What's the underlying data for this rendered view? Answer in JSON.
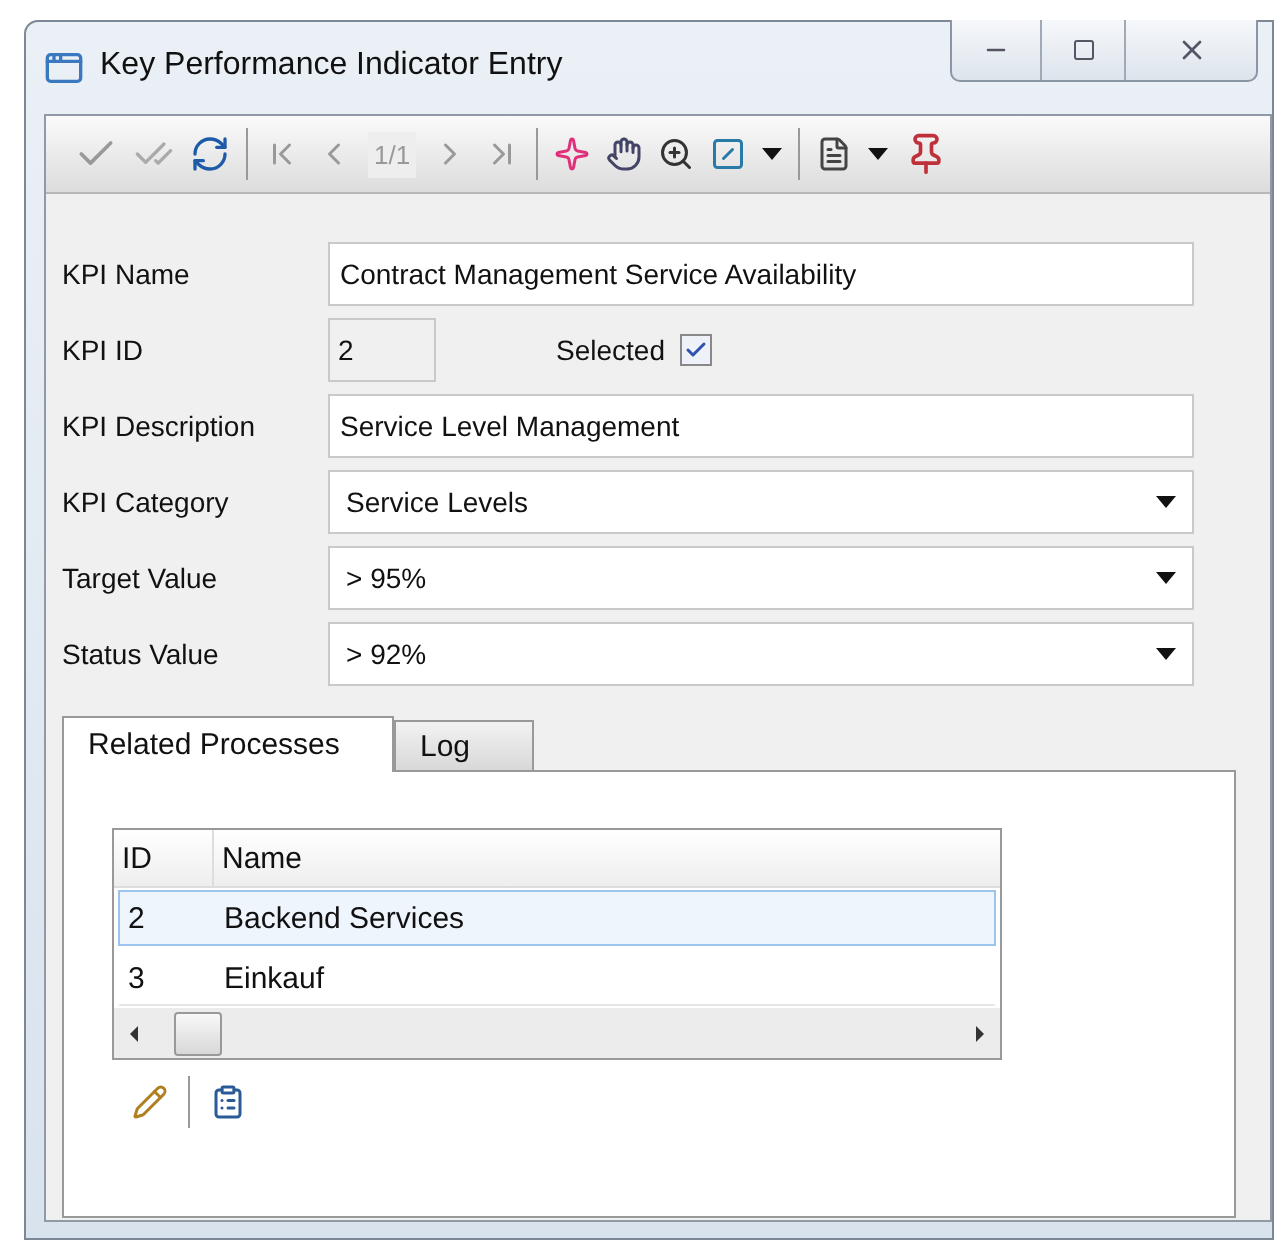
{
  "window": {
    "title": "Key Performance Indicator Entry"
  },
  "toolbar": {
    "pager": "1/1"
  },
  "form": [
    {
      "label": "KPI Name",
      "kind": "text",
      "value": "Contract Management Service Availability"
    },
    {
      "label": "KPI ID",
      "kind": "id",
      "value": "2",
      "checkbox": {
        "label": "Selected",
        "checked": true
      }
    },
    {
      "label": "KPI Description",
      "kind": "text",
      "value": "Service Level Management"
    },
    {
      "label": "KPI Category",
      "kind": "select",
      "value": "Service Levels"
    },
    {
      "label": "Target Value",
      "kind": "select",
      "value": "> 95%"
    },
    {
      "label": "Status Value",
      "kind": "select",
      "value": "> 92%"
    }
  ],
  "tabs": [
    {
      "label": "Related Processes",
      "selected": true
    },
    {
      "label": "Log",
      "selected": false
    }
  ],
  "table": {
    "columns": [
      "ID",
      "Name"
    ],
    "rows": [
      {
        "cells": [
          "2",
          "Backend Services"
        ],
        "selected": true
      },
      {
        "cells": [
          "3",
          "Einkauf"
        ],
        "selected": false
      }
    ]
  }
}
